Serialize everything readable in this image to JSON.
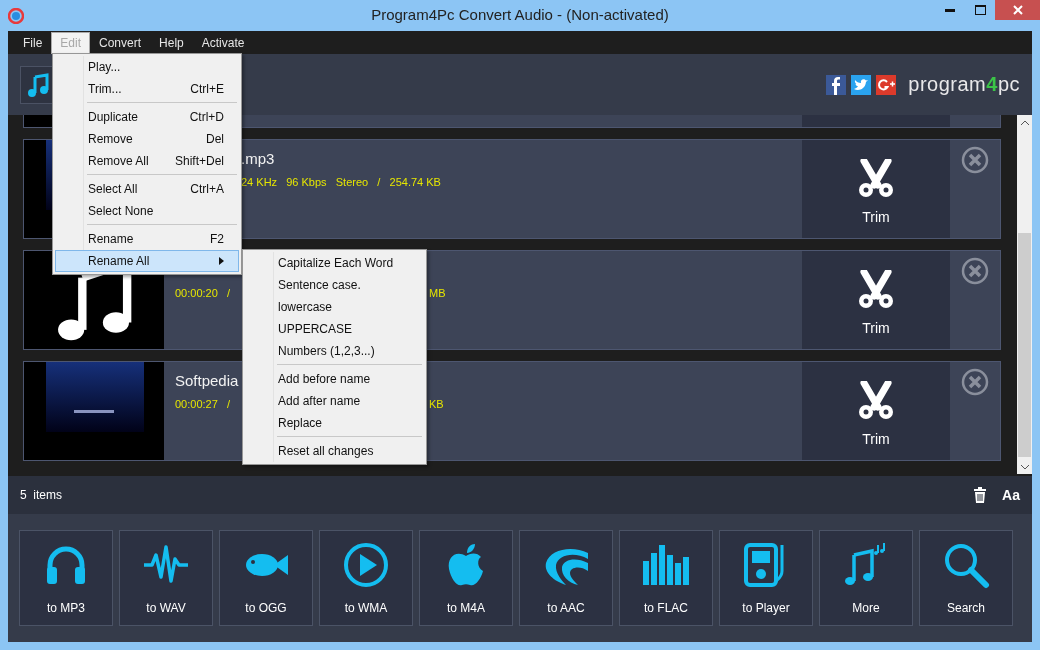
{
  "window": {
    "title": "Program4Pc Convert Audio - (Non-activated)"
  },
  "menu_bar": [
    {
      "label": "File",
      "open": false
    },
    {
      "label": "Edit",
      "open": true
    },
    {
      "label": "Convert",
      "open": false
    },
    {
      "label": "Help",
      "open": false
    },
    {
      "label": "Activate",
      "open": false
    }
  ],
  "header": {
    "logo": {
      "before": "program",
      "accent": "4",
      "after": "pc"
    }
  },
  "files": [
    {
      "name": ".mp3",
      "details": "24 KHz   96 Kbps   Stereo   /   254.74 KB",
      "trim": "Trim"
    },
    {
      "time": "00:00:20   /",
      "tail": "MB",
      "thumbnail": {
        "kind": "note"
      },
      "trim": "Trim"
    },
    {
      "name": "Softpedia",
      "time": "00:00:27   /",
      "tail": "KB",
      "trim": "Trim"
    }
  ],
  "status": {
    "count": "5  items",
    "font_button": "Aa"
  },
  "convert_buttons": [
    {
      "label": "to MP3"
    },
    {
      "label": "to WAV"
    },
    {
      "label": "to OGG"
    },
    {
      "label": "to WMA"
    },
    {
      "label": "to M4A"
    },
    {
      "label": "to AAC"
    },
    {
      "label": "to FLAC"
    },
    {
      "label": "to Player"
    },
    {
      "label": "More"
    },
    {
      "label": "Search"
    }
  ],
  "edit_menu": {
    "groups": [
      [
        {
          "label": "Play...",
          "selected": false,
          "submenu": false
        },
        {
          "label": "Trim...",
          "shortcut": "Ctrl+E",
          "selected": false,
          "submenu": false
        }
      ],
      [
        {
          "label": "Duplicate",
          "shortcut": "Ctrl+D",
          "selected": false,
          "submenu": false
        },
        {
          "label": "Remove",
          "shortcut": "Del",
          "selected": false,
          "submenu": false
        },
        {
          "label": "Remove All",
          "shortcut": "Shift+Del",
          "selected": false,
          "submenu": false
        }
      ],
      [
        {
          "label": "Select All",
          "shortcut": "Ctrl+A",
          "selected": false,
          "submenu": false
        },
        {
          "label": "Select None",
          "selected": false,
          "submenu": false
        }
      ],
      [
        {
          "label": "Rename",
          "shortcut": "F2",
          "selected": false,
          "submenu": false
        },
        {
          "label": "Rename All",
          "selected": true,
          "submenu": true
        }
      ]
    ]
  },
  "rename_submenu": {
    "groups": [
      [
        {
          "label": "Capitalize Each Word",
          "selected": false,
          "submenu": false
        },
        {
          "label": "Sentence case.",
          "selected": false,
          "submenu": false
        },
        {
          "label": "lowercase",
          "selected": false,
          "submenu": false
        },
        {
          "label": "UPPERCASE",
          "selected": false,
          "submenu": false
        },
        {
          "label": "Numbers (1,2,3...)",
          "selected": false,
          "submenu": false
        }
      ],
      [
        {
          "label": "Add before name",
          "selected": false,
          "submenu": false
        },
        {
          "label": "Add after name",
          "selected": false,
          "submenu": false
        },
        {
          "label": "Replace",
          "selected": false,
          "submenu": false
        }
      ],
      [
        {
          "label": "Reset all changes",
          "selected": false,
          "submenu": false
        }
      ]
    ]
  }
}
